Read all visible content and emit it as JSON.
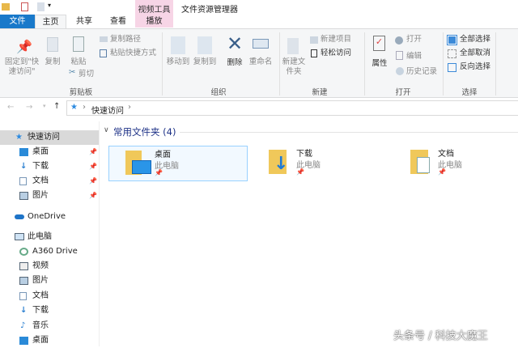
{
  "window": {
    "title": "文件资源管理器",
    "context_tab_group": "视频工具"
  },
  "tabs": [
    {
      "label": "文件"
    },
    {
      "label": "主页"
    },
    {
      "label": "共享"
    },
    {
      "label": "查看"
    },
    {
      "label": "播放"
    }
  ],
  "ribbon": {
    "clipboard": {
      "pin": "固定到\"快速访问\"",
      "copy": "复制",
      "paste": "粘贴",
      "copy_path": "复制路径",
      "paste_shortcut": "粘贴快捷方式",
      "cut": "剪切",
      "group": "剪贴板"
    },
    "organize": {
      "move_to": "移动到",
      "copy_to": "复制到",
      "delete": "删除",
      "rename": "重命名",
      "group": "组织"
    },
    "new": {
      "new_folder": "新建文件夹",
      "new_item": "新建项目",
      "easy_access": "轻松访问",
      "group": "新建"
    },
    "open": {
      "properties": "属性",
      "open": "打开",
      "edit": "编辑",
      "history": "历史记录",
      "group": "打开"
    },
    "select": {
      "select_all": "全部选择",
      "select_none": "全部取消",
      "invert": "反向选择",
      "group": "选择"
    }
  },
  "address": {
    "path": "快速访问"
  },
  "sidebar": {
    "items": [
      {
        "label": "快速访问"
      },
      {
        "label": "桌面"
      },
      {
        "label": "下载"
      },
      {
        "label": "文档"
      },
      {
        "label": "图片"
      },
      {
        "label": "OneDrive"
      },
      {
        "label": "此电脑"
      },
      {
        "label": "A360 Drive"
      },
      {
        "label": "视频"
      },
      {
        "label": "图片"
      },
      {
        "label": "文档"
      },
      {
        "label": "下载"
      },
      {
        "label": "音乐"
      },
      {
        "label": "桌面"
      }
    ]
  },
  "main": {
    "section": "常用文件夹 (4)",
    "folders": [
      {
        "name": "桌面",
        "location": "此电脑"
      },
      {
        "name": "下载",
        "location": "此电脑"
      },
      {
        "name": "文档",
        "location": "此电脑"
      }
    ]
  },
  "watermark": "头条号 / 科技大魔王"
}
